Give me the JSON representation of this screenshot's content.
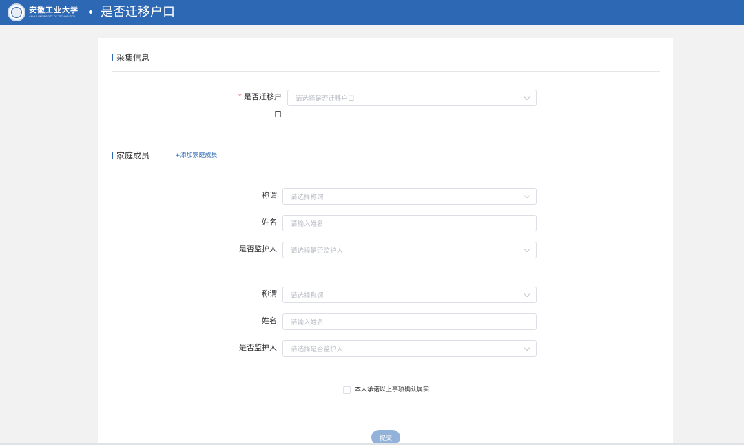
{
  "header": {
    "logo_cn": "安徽工业大学",
    "logo_en": "ANHUI UNIVERSITY OF TECHNOLOGY",
    "page_title": "是否迁移户口",
    "bar_color": "#2c68b3"
  },
  "section_collect": {
    "title": "采集信息",
    "migrate_label": "是否迁移户口",
    "migrate_required_mark": "*",
    "migrate_placeholder": "请选择是否迁移户口"
  },
  "section_family": {
    "title": "家庭成员",
    "add_link": "+添加家庭成员",
    "members": [
      {
        "relation_label": "称谓",
        "relation_placeholder": "请选择称谓",
        "name_label": "姓名",
        "name_placeholder": "请输入姓名",
        "guardian_label": "是否监护人",
        "guardian_placeholder": "请选择是否监护人"
      },
      {
        "relation_label": "称谓",
        "relation_placeholder": "请选择称谓",
        "name_label": "姓名",
        "name_placeholder": "请输入姓名",
        "guardian_label": "是否监护人",
        "guardian_placeholder": "请选择是否监护人"
      }
    ]
  },
  "pledge": {
    "text": "本人承诺以上事项确认属实",
    "checked": false
  },
  "submit": {
    "label": "提交"
  },
  "icons": {
    "logo": "university-seal-icon",
    "select_arrow": "chevron-down-icon",
    "checkbox": "checkbox-icon"
  }
}
